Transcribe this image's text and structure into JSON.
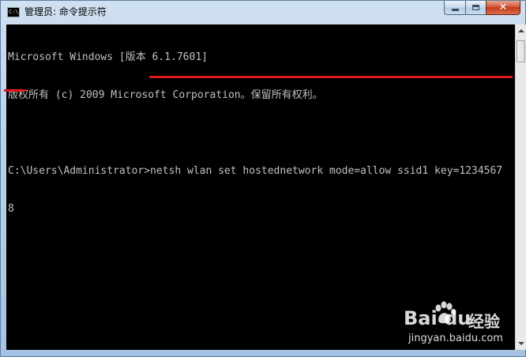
{
  "window": {
    "title": "管理员: 命令提示符",
    "icon": "console-app-icon",
    "controls": {
      "minimize": "minimize-icon",
      "maximize": "maximize-icon",
      "close": "close-icon"
    }
  },
  "console": {
    "lines": [
      "Microsoft Windows [版本 6.1.7601]",
      "版权所有 (c) 2009 Microsoft Corporation。保留所有权利。",
      "",
      "C:\\Users\\Administrator>netsh wlan set hostednetwork mode=allow ssid1 key=1234567",
      "8"
    ],
    "text_color": "#c0c0c0",
    "background": "#000000",
    "highlight_color": "#e01818"
  },
  "watermark": {
    "brand": "Bai du",
    "brand_cn": "经验",
    "url": "jingyan.baidu.com"
  }
}
